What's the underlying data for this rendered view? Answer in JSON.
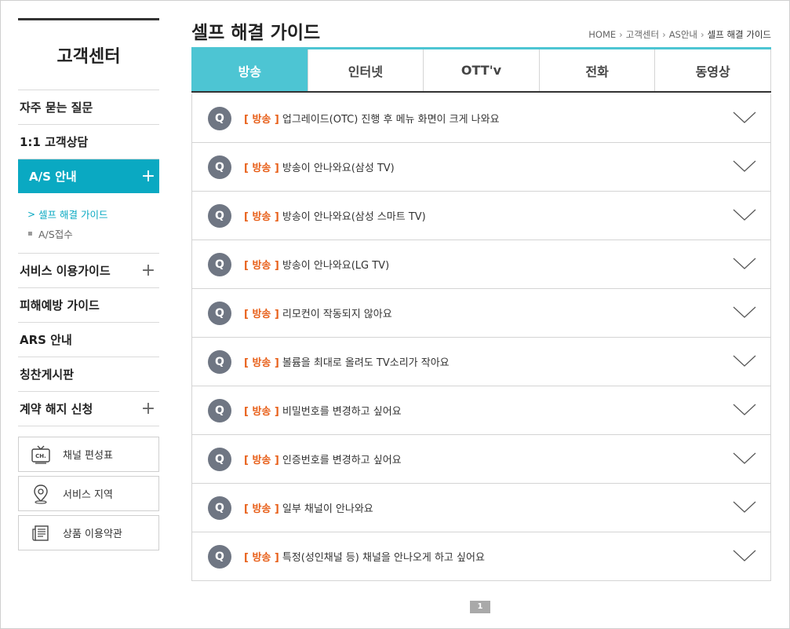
{
  "sidebar": {
    "title": "고객센터",
    "menu": [
      {
        "label": "자주 묻는 질문",
        "plus": ""
      },
      {
        "label": "1:1 고객상담",
        "plus": ""
      },
      {
        "label": "A/S 안내",
        "plus": "+"
      },
      {
        "label": "서비스 이용가이드",
        "plus": "+"
      },
      {
        "label": "피해예방 가이드",
        "plus": ""
      },
      {
        "label": "ARS 안내",
        "plus": ""
      },
      {
        "label": "칭찬게시판",
        "plus": ""
      },
      {
        "label": "계약 해지 신청",
        "plus": "+"
      }
    ],
    "submenu": [
      {
        "mark": ">",
        "label": "셀프 해결 가이드"
      },
      {
        "mark": "▪",
        "label": "A/S접수"
      }
    ],
    "quick_links": [
      {
        "label": "채널 편성표",
        "icon": "tv-channel-icon",
        "icon_text": "CH."
      },
      {
        "label": "서비스 지역",
        "icon": "map-pin-icon"
      },
      {
        "label": "상품 이용약관",
        "icon": "document-icon"
      }
    ]
  },
  "main": {
    "title": "셀프 해결 가이드",
    "breadcrumb": [
      "HOME",
      "고객센터",
      "AS안내",
      "셀프 해결 가이드"
    ],
    "breadcrumb_sep": "›",
    "tabs": [
      {
        "label": "방송",
        "active": true
      },
      {
        "label": "인터넷",
        "active": false
      },
      {
        "label": "OTT'v",
        "active": false
      },
      {
        "label": "전화",
        "active": false
      },
      {
        "label": "동영상",
        "active": false
      }
    ],
    "q_label": "Q",
    "category": "[ 방송 ]",
    "faqs": [
      "업그레이드(OTC) 진행 후 메뉴 화면이 크게 나와요",
      "방송이 안나와요(삼성 TV)",
      "방송이 안나와요(삼성 스마트 TV)",
      "방송이 안나와요(LG TV)",
      "리모컨이 작동되지 않아요",
      "볼륨을 최대로 올려도 TV소리가 작아요",
      "비밀번호를 변경하고 싶어요",
      "인증번호를 변경하고 싶어요",
      "일부 채널이 안나와요",
      "특정(성인채널 등) 채널을 안나오게 하고 싶어요"
    ]
  },
  "pagination": {
    "current": "1"
  },
  "colors": {
    "accent": "#0aa9c2",
    "tab_active": "#4dc5d3",
    "category": "#e8601a",
    "q_badge": "#6f7683"
  }
}
